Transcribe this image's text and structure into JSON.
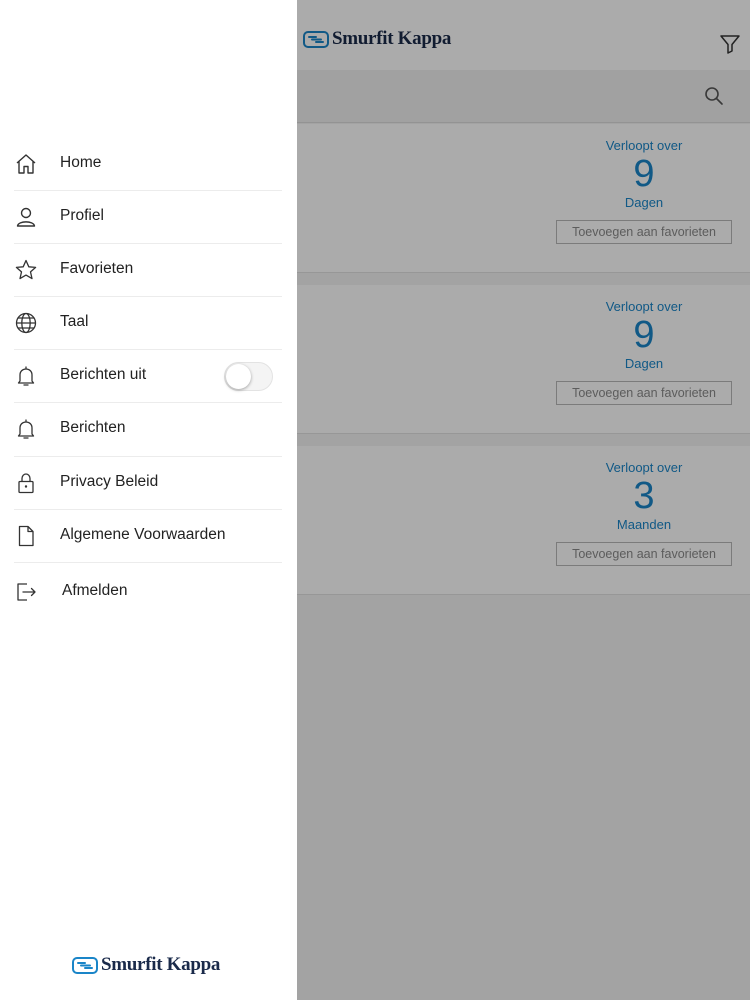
{
  "app": {
    "logo_text": "Smurfit Kappa",
    "cards": [
      {
        "expiry_label": "Verloopt over",
        "expiry_value": "9",
        "expiry_unit": "Dagen",
        "fav_button": "Toevoegen aan favorieten"
      },
      {
        "expiry_label": "Verloopt over",
        "expiry_value": "9",
        "expiry_unit": "Dagen",
        "fav_button": "Toevoegen aan favorieten"
      },
      {
        "expiry_label": "Verloopt over",
        "expiry_value": "3",
        "expiry_unit": "Maanden",
        "fav_button": "Toevoegen aan favorieten"
      }
    ]
  },
  "drawer": {
    "items": [
      {
        "label": "Home",
        "icon": "home-icon"
      },
      {
        "label": "Profiel",
        "icon": "user-icon"
      },
      {
        "label": "Favorieten",
        "icon": "star-icon"
      },
      {
        "label": "Taal",
        "icon": "globe-icon"
      },
      {
        "label": "Berichten uit",
        "icon": "bell-icon",
        "toggle": false
      },
      {
        "label": "Berichten",
        "icon": "bell-icon"
      },
      {
        "label": "Privacy Beleid",
        "icon": "lock-icon"
      },
      {
        "label": "Algemene Voorwaarden",
        "icon": "document-icon"
      },
      {
        "label": "Afmelden",
        "icon": "logout-icon"
      }
    ],
    "logo_text": "Smurfit Kappa"
  },
  "colors": {
    "accent": "#1a85c8",
    "brand": "#1a2a4a",
    "overlay": "rgba(0,0,0,0.33)"
  }
}
